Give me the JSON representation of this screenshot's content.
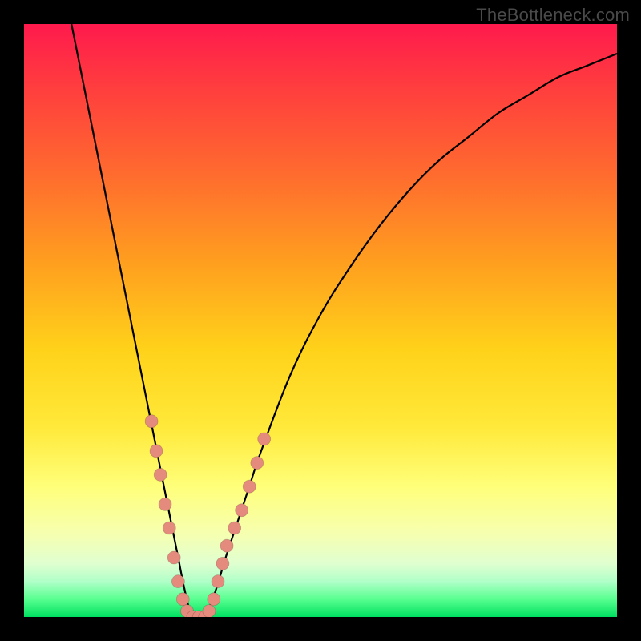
{
  "watermark": {
    "text": "TheBottleneck.com"
  },
  "colors": {
    "gradient_stops": [
      "#ff1a4d",
      "#ff3b3f",
      "#ff6a2f",
      "#ff9e1f",
      "#ffd21a",
      "#ffe93a",
      "#ffff7a",
      "#f6ffb0",
      "#e0ffd0",
      "#b0ffc8",
      "#58ff90",
      "#00e060"
    ],
    "curve": "#000000",
    "marker_fill": "#e58b7d",
    "frame_bg": "#000000"
  },
  "chart_data": {
    "type": "line",
    "title": "",
    "xlabel": "",
    "ylabel": "",
    "x_range": [
      0,
      100
    ],
    "y_range": [
      0,
      100
    ],
    "grid": false,
    "legend": false,
    "note": "No axes or tick labels are rendered in the image. y is approximate bottleneck % (100 at top, 0 at bottom); x is relative position left→right. Values are visually estimated from the curve.",
    "series": [
      {
        "name": "bottleneck-curve",
        "x": [
          8,
          10,
          12,
          14,
          16,
          18,
          20,
          21,
          22,
          23,
          24,
          25,
          26,
          27,
          28,
          29,
          30,
          31,
          32.5,
          34,
          36,
          38,
          40,
          45,
          50,
          55,
          60,
          65,
          70,
          75,
          80,
          85,
          90,
          95,
          100
        ],
        "values": [
          100,
          90,
          80,
          70,
          60,
          50,
          40,
          35,
          30,
          25,
          20,
          15,
          10,
          5,
          1,
          0,
          0,
          1,
          5,
          10,
          16,
          22,
          28,
          41,
          51,
          59,
          66,
          72,
          77,
          81,
          85,
          88,
          91,
          93,
          95
        ]
      }
    ],
    "markers": {
      "name": "highlighted-points",
      "note": "Salmon circular markers near the valley of the curve.",
      "points": [
        {
          "x": 21.5,
          "y": 33
        },
        {
          "x": 22.3,
          "y": 28
        },
        {
          "x": 23.0,
          "y": 24
        },
        {
          "x": 23.8,
          "y": 19
        },
        {
          "x": 24.5,
          "y": 15
        },
        {
          "x": 25.3,
          "y": 10
        },
        {
          "x": 26.0,
          "y": 6
        },
        {
          "x": 26.8,
          "y": 3
        },
        {
          "x": 27.5,
          "y": 1
        },
        {
          "x": 28.5,
          "y": 0
        },
        {
          "x": 29.5,
          "y": 0
        },
        {
          "x": 30.5,
          "y": 0
        },
        {
          "x": 31.2,
          "y": 1
        },
        {
          "x": 32.0,
          "y": 3
        },
        {
          "x": 32.7,
          "y": 6
        },
        {
          "x": 33.5,
          "y": 9
        },
        {
          "x": 34.2,
          "y": 12
        },
        {
          "x": 35.5,
          "y": 15
        },
        {
          "x": 36.7,
          "y": 18
        },
        {
          "x": 38.0,
          "y": 22
        },
        {
          "x": 39.3,
          "y": 26
        },
        {
          "x": 40.5,
          "y": 30
        }
      ]
    }
  }
}
